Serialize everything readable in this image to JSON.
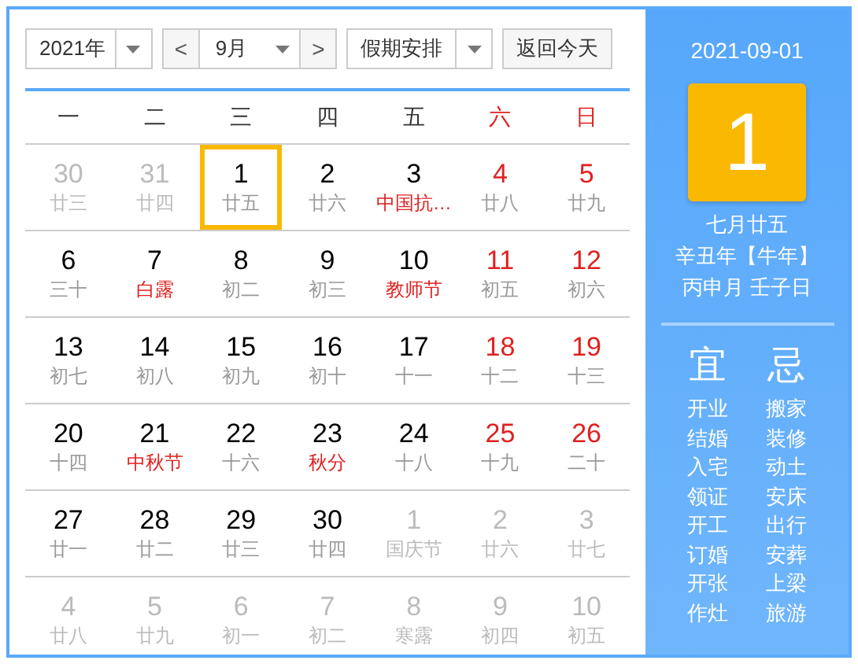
{
  "toolbar": {
    "year": "2021年",
    "prev": "<",
    "month": "9月",
    "next": ">",
    "holiday": "假期安排",
    "today_button": "返回今天"
  },
  "weekdays": [
    {
      "label": "一",
      "weekend": false
    },
    {
      "label": "二",
      "weekend": false
    },
    {
      "label": "三",
      "weekend": false
    },
    {
      "label": "四",
      "weekend": false
    },
    {
      "label": "五",
      "weekend": false
    },
    {
      "label": "六",
      "weekend": true
    },
    {
      "label": "日",
      "weekend": true
    }
  ],
  "weeks": [
    [
      {
        "day": "30",
        "lunar": "廿三",
        "muted": true
      },
      {
        "day": "31",
        "lunar": "廿四",
        "muted": true
      },
      {
        "day": "1",
        "lunar": "廿五",
        "muted": false,
        "weekend": false,
        "festival": false,
        "selected": true
      },
      {
        "day": "2",
        "lunar": "廿六",
        "muted": false,
        "weekend": false,
        "festival": false,
        "selected": false
      },
      {
        "day": "3",
        "lunar": "中国抗…",
        "muted": false,
        "weekend": false,
        "festival": true,
        "selected": false
      },
      {
        "day": "4",
        "lunar": "廿八",
        "muted": false,
        "weekend": true,
        "festival": false,
        "selected": false
      },
      {
        "day": "5",
        "lunar": "廿九",
        "muted": false,
        "weekend": true,
        "festival": false,
        "selected": false
      }
    ],
    [
      {
        "day": "6",
        "lunar": "三十",
        "muted": false,
        "weekend": false,
        "festival": false,
        "selected": false
      },
      {
        "day": "7",
        "lunar": "白露",
        "muted": false,
        "weekend": false,
        "festival": true,
        "selected": false
      },
      {
        "day": "8",
        "lunar": "初二",
        "muted": false,
        "weekend": false,
        "festival": false,
        "selected": false
      },
      {
        "day": "9",
        "lunar": "初三",
        "muted": false,
        "weekend": false,
        "festival": false,
        "selected": false
      },
      {
        "day": "10",
        "lunar": "教师节",
        "muted": false,
        "weekend": false,
        "festival": true,
        "selected": false
      },
      {
        "day": "11",
        "lunar": "初五",
        "muted": false,
        "weekend": true,
        "festival": false,
        "selected": false
      },
      {
        "day": "12",
        "lunar": "初六",
        "muted": false,
        "weekend": true,
        "festival": false,
        "selected": false
      }
    ],
    [
      {
        "day": "13",
        "lunar": "初七",
        "muted": false,
        "weekend": false,
        "festival": false,
        "selected": false
      },
      {
        "day": "14",
        "lunar": "初八",
        "muted": false,
        "weekend": false,
        "festival": false,
        "selected": false
      },
      {
        "day": "15",
        "lunar": "初九",
        "muted": false,
        "weekend": false,
        "festival": false,
        "selected": false
      },
      {
        "day": "16",
        "lunar": "初十",
        "muted": false,
        "weekend": false,
        "festival": false,
        "selected": false
      },
      {
        "day": "17",
        "lunar": "十一",
        "muted": false,
        "weekend": false,
        "festival": false,
        "selected": false
      },
      {
        "day": "18",
        "lunar": "十二",
        "muted": false,
        "weekend": true,
        "festival": false,
        "selected": false
      },
      {
        "day": "19",
        "lunar": "十三",
        "muted": false,
        "weekend": true,
        "festival": false,
        "selected": false
      }
    ],
    [
      {
        "day": "20",
        "lunar": "十四",
        "muted": false,
        "weekend": false,
        "festival": false,
        "selected": false
      },
      {
        "day": "21",
        "lunar": "中秋节",
        "muted": false,
        "weekend": false,
        "festival": true,
        "selected": false
      },
      {
        "day": "22",
        "lunar": "十六",
        "muted": false,
        "weekend": false,
        "festival": false,
        "selected": false
      },
      {
        "day": "23",
        "lunar": "秋分",
        "muted": false,
        "weekend": false,
        "festival": true,
        "selected": false
      },
      {
        "day": "24",
        "lunar": "十八",
        "muted": false,
        "weekend": false,
        "festival": false,
        "selected": false
      },
      {
        "day": "25",
        "lunar": "十九",
        "muted": false,
        "weekend": true,
        "festival": false,
        "selected": false
      },
      {
        "day": "26",
        "lunar": "二十",
        "muted": false,
        "weekend": true,
        "festival": false,
        "selected": false
      }
    ],
    [
      {
        "day": "27",
        "lunar": "廿一",
        "muted": false,
        "weekend": false,
        "festival": false,
        "selected": false
      },
      {
        "day": "28",
        "lunar": "廿二",
        "muted": false,
        "weekend": false,
        "festival": false,
        "selected": false
      },
      {
        "day": "29",
        "lunar": "廿三",
        "muted": false,
        "weekend": false,
        "festival": false,
        "selected": false
      },
      {
        "day": "30",
        "lunar": "廿四",
        "muted": false,
        "weekend": false,
        "festival": false,
        "selected": false
      },
      {
        "day": "1",
        "lunar": "国庆节",
        "muted": true
      },
      {
        "day": "2",
        "lunar": "廿六",
        "muted": true
      },
      {
        "day": "3",
        "lunar": "廿七",
        "muted": true
      }
    ],
    [
      {
        "day": "4",
        "lunar": "廿八",
        "muted": true
      },
      {
        "day": "5",
        "lunar": "廿九",
        "muted": true
      },
      {
        "day": "6",
        "lunar": "初一",
        "muted": true
      },
      {
        "day": "7",
        "lunar": "初二",
        "muted": true
      },
      {
        "day": "8",
        "lunar": "寒露",
        "muted": true
      },
      {
        "day": "9",
        "lunar": "初四",
        "muted": true
      },
      {
        "day": "10",
        "lunar": "初五",
        "muted": true
      }
    ]
  ],
  "detail": {
    "date": "2021-09-01",
    "day": "1",
    "lunar_lines": [
      "七月廿五",
      "辛丑年【牛年】",
      "丙申月 壬子日"
    ],
    "suitable": {
      "heading": "宜",
      "items": [
        "开业",
        "结婚",
        "入宅",
        "领证",
        "开工",
        "订婚",
        "开张",
        "作灶"
      ]
    },
    "avoid": {
      "heading": "忌",
      "items": [
        "搬家",
        "装修",
        "动土",
        "安床",
        "出行",
        "安葬",
        "上梁",
        "旅游"
      ]
    }
  }
}
